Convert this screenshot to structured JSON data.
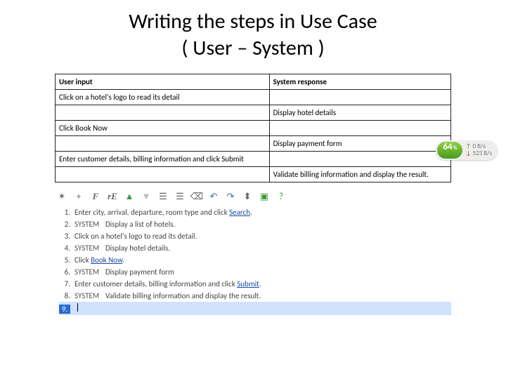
{
  "title_line1": "Writing the steps in Use Case",
  "title_line2": "( User – System )",
  "table": {
    "headers": {
      "user": "User input",
      "system": "System response"
    },
    "rows": [
      {
        "user": "Click on a hotel's logo to read its detail",
        "system": ""
      },
      {
        "user": "",
        "system": "Display hotel details"
      },
      {
        "user": "Click Book Now",
        "system": ""
      },
      {
        "user": "",
        "system": "Display payment form"
      },
      {
        "user": "Enter customer details, billing information and click Submit",
        "system": ""
      },
      {
        "user": "",
        "system": "Validate billing information and display the result."
      }
    ]
  },
  "toolbar_icons": [
    "sparkle",
    "plus",
    "F-italic",
    "re-italic",
    "caret-up",
    "caret-down",
    "indent-left",
    "indent-right",
    "eraser",
    "undo",
    "redo",
    "split",
    "box-green",
    "help"
  ],
  "steps": [
    {
      "n": "1.",
      "system": false,
      "text_pre": "Enter city, arrival, departure, room type and click ",
      "link": "Search",
      "text_post": "."
    },
    {
      "n": "2.",
      "system": true,
      "text_pre": "Display a list of hotels.",
      "link": "",
      "text_post": ""
    },
    {
      "n": "3.",
      "system": false,
      "text_pre": "Click on a hotel's logo to read its detail.",
      "link": "",
      "text_post": ""
    },
    {
      "n": "4.",
      "system": true,
      "text_pre": "Display hotel details.",
      "link": "",
      "text_post": ""
    },
    {
      "n": "5.",
      "system": false,
      "text_pre": "Click ",
      "link": "Book Now",
      "text_post": "."
    },
    {
      "n": "6.",
      "system": true,
      "text_pre": "Display payment form",
      "link": "",
      "text_post": ""
    },
    {
      "n": "7.",
      "system": false,
      "text_pre": "Enter customer details, billing information and click ",
      "link": "Submit",
      "text_post": "."
    },
    {
      "n": "8.",
      "system": true,
      "text_pre": "Validate billing information and display the result.",
      "link": "",
      "text_post": ""
    }
  ],
  "active_step_num": "9.",
  "system_label": "SYSTEM",
  "network": {
    "value": "64",
    "pct": "%",
    "up": "0 B/s",
    "down": "523 B/s"
  }
}
